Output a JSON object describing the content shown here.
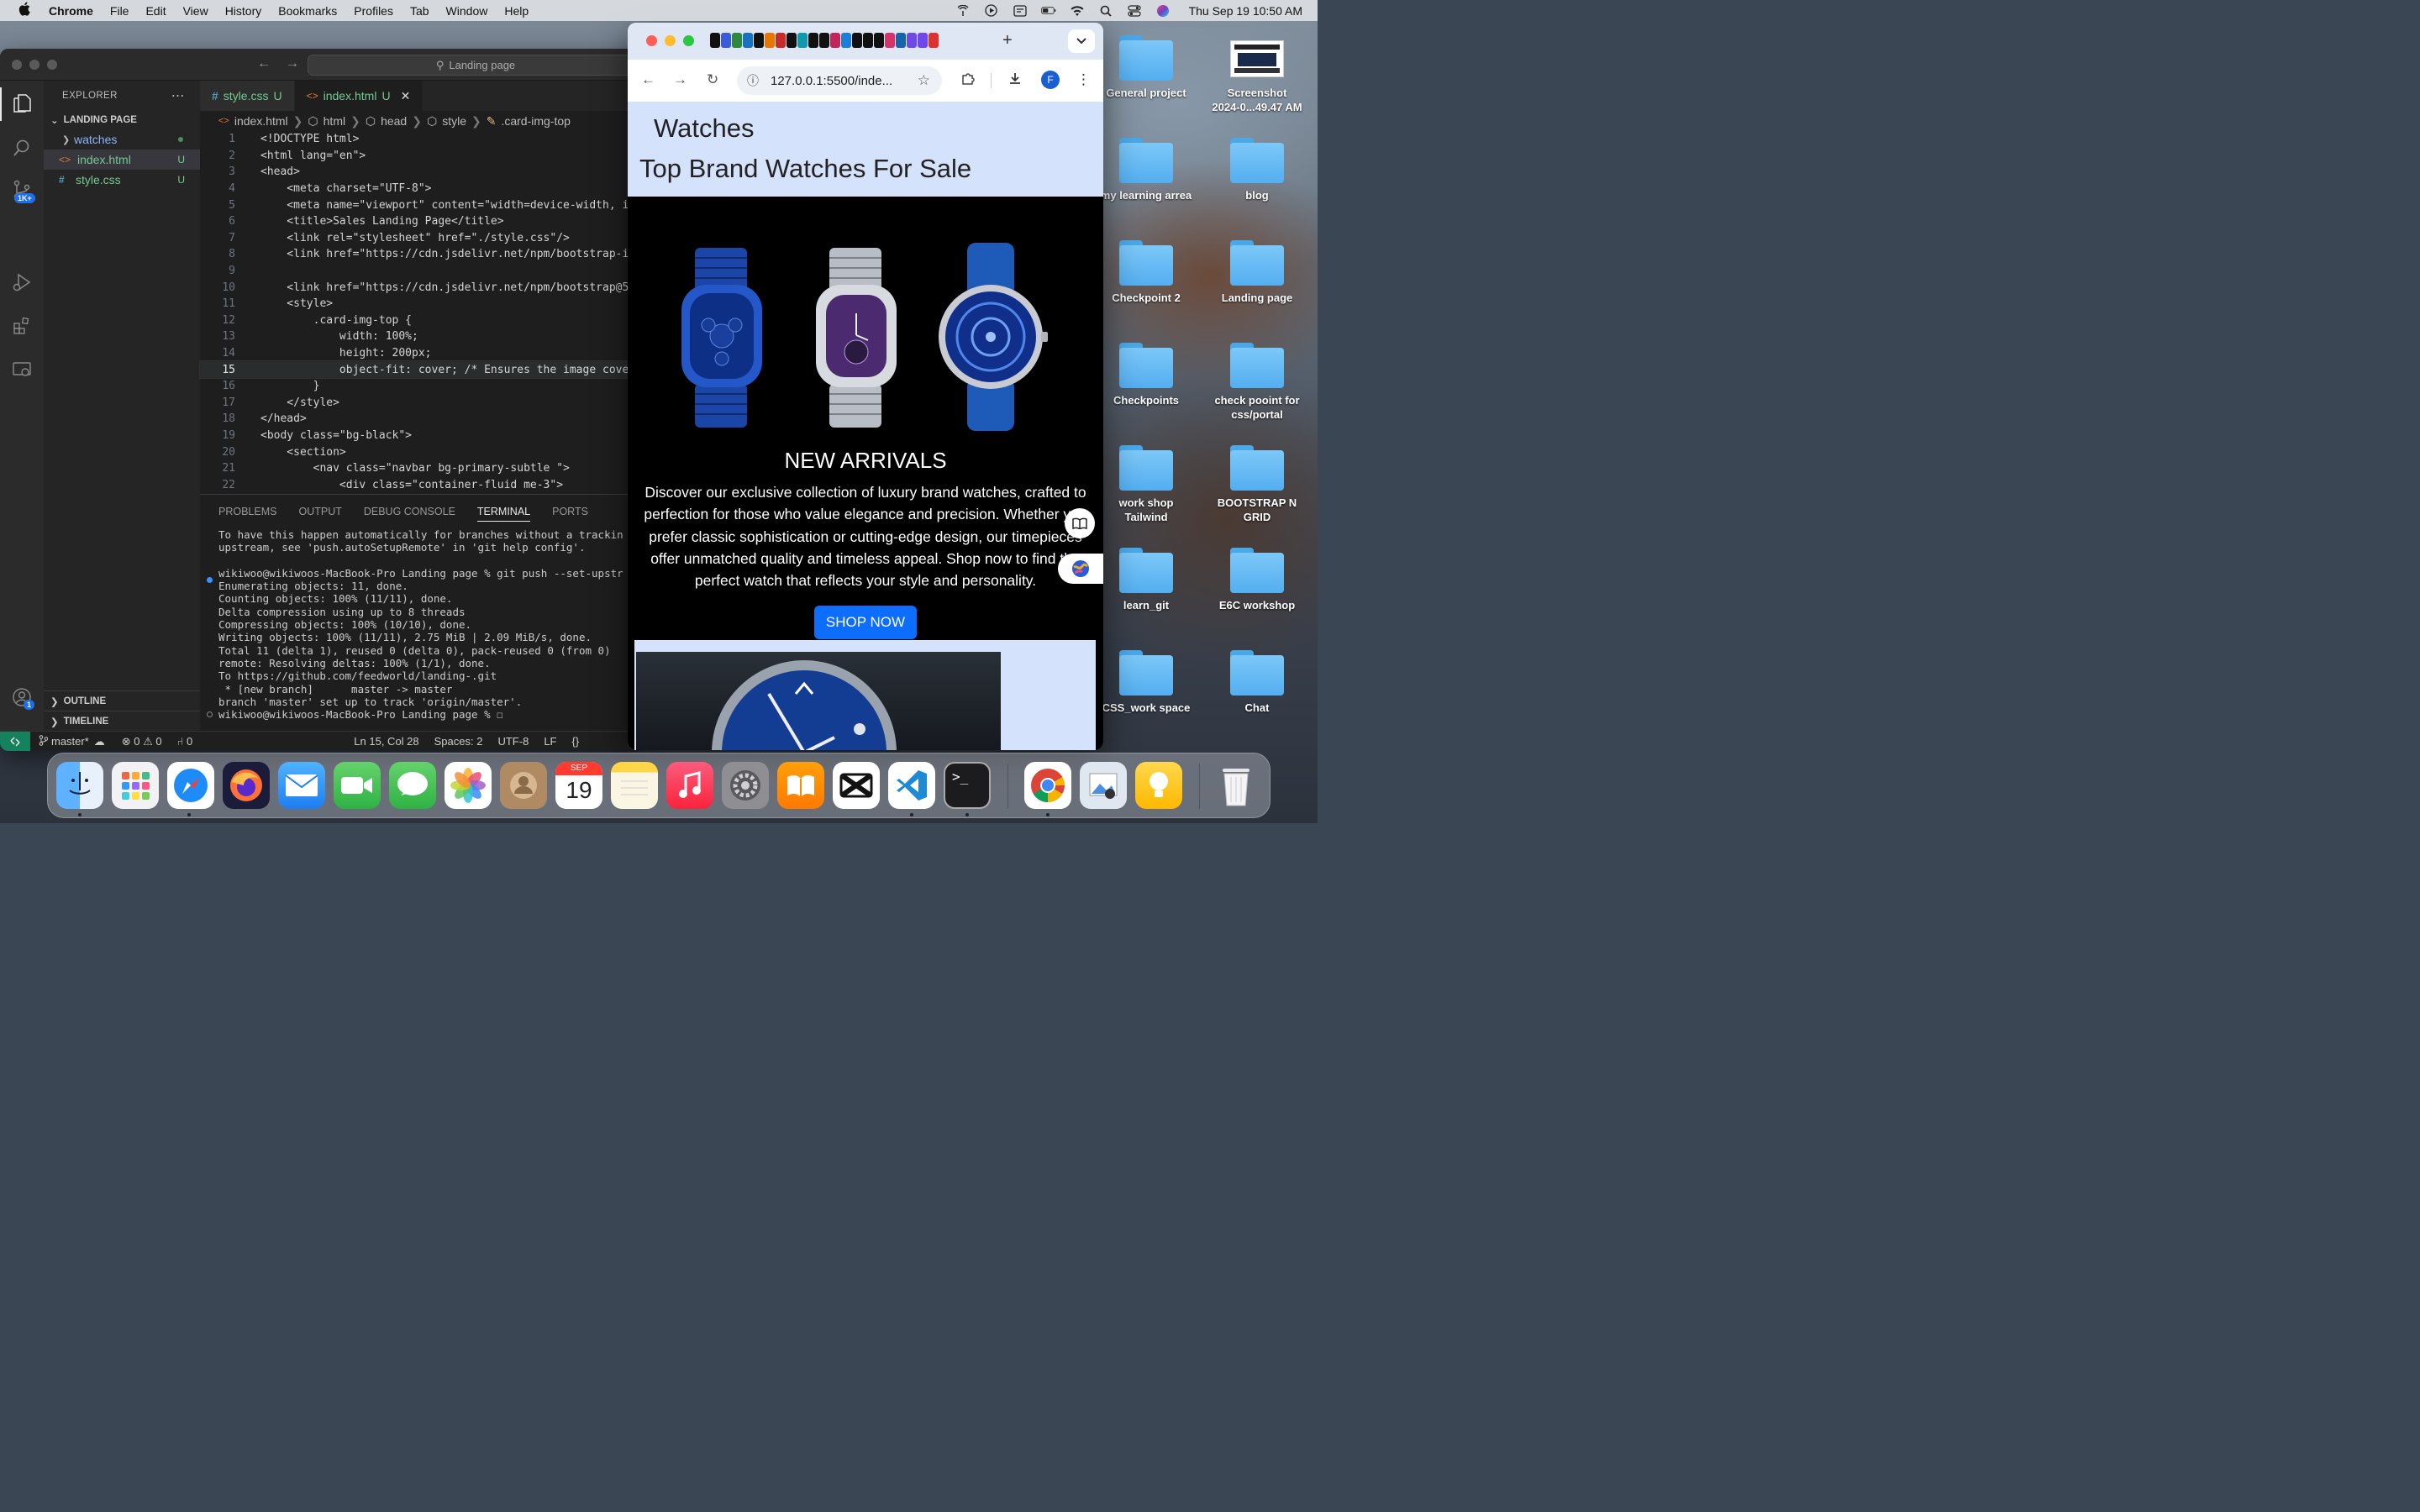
{
  "menubar": {
    "app": "Chrome",
    "items": [
      "File",
      "Edit",
      "View",
      "History",
      "Bookmarks",
      "Profiles",
      "Tab",
      "Window",
      "Help"
    ],
    "clock": "Thu Sep 19  10:50 AM"
  },
  "vscode": {
    "search_placeholder": "Landing page",
    "explorer": {
      "title": "EXPLORER",
      "project": "LANDING PAGE",
      "files": [
        {
          "name": "watches",
          "type": "folder",
          "mark": ""
        },
        {
          "name": "index.html",
          "type": "html",
          "mark": "U"
        },
        {
          "name": "style.css",
          "type": "css",
          "mark": "U"
        }
      ],
      "outline": "OUTLINE",
      "timeline": "TIMELINE"
    },
    "badges": {
      "source_control": "1K+",
      "accounts": "1"
    },
    "tabs": [
      {
        "name": "style.css",
        "mark": "U"
      },
      {
        "name": "index.html",
        "mark": "U"
      }
    ],
    "breadcrumb": [
      "index.html",
      "html",
      "head",
      "style",
      ".card-img-top"
    ],
    "code": [
      {
        "n": "1",
        "t": "<!DOCTYPE html>"
      },
      {
        "n": "2",
        "t": "<html lang=\"en\">"
      },
      {
        "n": "3",
        "t": "<head>"
      },
      {
        "n": "4",
        "t": "    <meta charset=\"UTF-8\">"
      },
      {
        "n": "5",
        "t": "    <meta name=\"viewport\" content=\"width=device-width, i"
      },
      {
        "n": "6",
        "t": "    <title>Sales Landing Page</title>"
      },
      {
        "n": "7",
        "t": "    <link rel=\"stylesheet\" href=\"./style.css\"/>"
      },
      {
        "n": "8",
        "t": "    <link href=\"https://cdn.jsdelivr.net/npm/bootstrap-i"
      },
      {
        "n": "9",
        "t": ""
      },
      {
        "n": "10",
        "t": "    <link href=\"https://cdn.jsdelivr.net/npm/bootstrap@5"
      },
      {
        "n": "11",
        "t": "    <style>"
      },
      {
        "n": "12",
        "t": "        .card-img-top {"
      },
      {
        "n": "13",
        "t": "            width: 100%;"
      },
      {
        "n": "14",
        "t": "            height: 200px;"
      },
      {
        "n": "15",
        "t": "            object-fit: cover; /* Ensures the image cove"
      },
      {
        "n": "16",
        "t": "        }"
      },
      {
        "n": "17",
        "t": "    </style>"
      },
      {
        "n": "18",
        "t": "</head>"
      },
      {
        "n": "19",
        "t": "<body class=\"bg-black\">"
      },
      {
        "n": "20",
        "t": "    <section>"
      },
      {
        "n": "21",
        "t": "        <nav class=\"navbar bg-primary-subtle \">"
      },
      {
        "n": "22",
        "t": "            <div class=\"container-fluid me-3\">"
      }
    ],
    "panel_tabs": [
      "PROBLEMS",
      "OUTPUT",
      "DEBUG CONSOLE",
      "TERMINAL",
      "PORTS"
    ],
    "terminal": [
      "To have this happen automatically for branches without a trackin",
      "upstream, see 'push.autoSetupRemote' in 'git help config'.",
      "",
      "wikiwoo@wikiwoos-MacBook-Pro Landing page % git push --set-upstr",
      "Enumerating objects: 11, done.",
      "Counting objects: 100% (11/11), done.",
      "Delta compression using up to 8 threads",
      "Compressing objects: 100% (10/10), done.",
      "Writing objects: 100% (11/11), 2.75 MiB | 2.09 MiB/s, done.",
      "Total 11 (delta 1), reused 0 (delta 0), pack-reused 0 (from 0)",
      "remote: Resolving deltas: 100% (1/1), done.",
      "To https://github.com/feedworld/landing-.git",
      " * [new branch]      master -> master",
      "branch 'master' set up to track 'origin/master'.",
      "wikiwoo@wikiwoos-MacBook-Pro Landing page % ☐"
    ],
    "status": {
      "branch": "master*",
      "problems": "⊗ 0 ⚠ 0",
      "ports": "⑁ 0",
      "cursor": "Ln 15, Col 28",
      "spaces": "Spaces: 2",
      "encoding": "UTF-8",
      "eol": "LF",
      "lang": "{}"
    }
  },
  "chrome": {
    "url": "127.0.0.1:5500/inde...",
    "profile": "F",
    "page": {
      "brand": "Watches",
      "headline": "Top Brand Watches For Sale",
      "hero_title": "NEW ARRIVALS",
      "hero_text": "Discover our exclusive collection of luxury brand watches, crafted to perfection for those who value elegance and precision. Whether you prefer classic sophistication or cutting-edge design, our timepieces offer unmatched quality and timeless appeal. Shop now to find the perfect watch that reflects your style and personality.",
      "cta": "SHOP NOW"
    }
  },
  "desktop": {
    "icons": [
      {
        "label": "General project"
      },
      {
        "label": "Screenshot\n2024-0...49.47 AM"
      },
      {
        "label": "my learning arrea"
      },
      {
        "label": "blog"
      },
      {
        "label": "Checkpoint 2"
      },
      {
        "label": "Landing page"
      },
      {
        "label": "Checkpoints"
      },
      {
        "label": "check pooint for\ncss/portal"
      },
      {
        "label": "work shop\nTailwind"
      },
      {
        "label": "BOOTSTRAP N\nGRID"
      },
      {
        "label": "learn_git"
      },
      {
        "label": "E6C workshop"
      },
      {
        "label": "CSS_work space"
      },
      {
        "label": "Chat"
      }
    ]
  },
  "dock": {
    "calendar_month": "SEP",
    "calendar_day": "19",
    "apps": [
      "finder-icon",
      "launchpad-icon",
      "safari-icon",
      "firefox-icon",
      "mail-icon",
      "facetime-icon",
      "messages-icon",
      "photos-icon",
      "contacts-icon",
      "calendar-icon",
      "notes-icon",
      "music-icon",
      "system-settings-icon",
      "books-icon",
      "capcut-icon",
      "vscode-icon",
      "terminal-icon",
      "chrome-icon",
      "preview-icon",
      "tips-icon",
      "trash-icon"
    ]
  }
}
